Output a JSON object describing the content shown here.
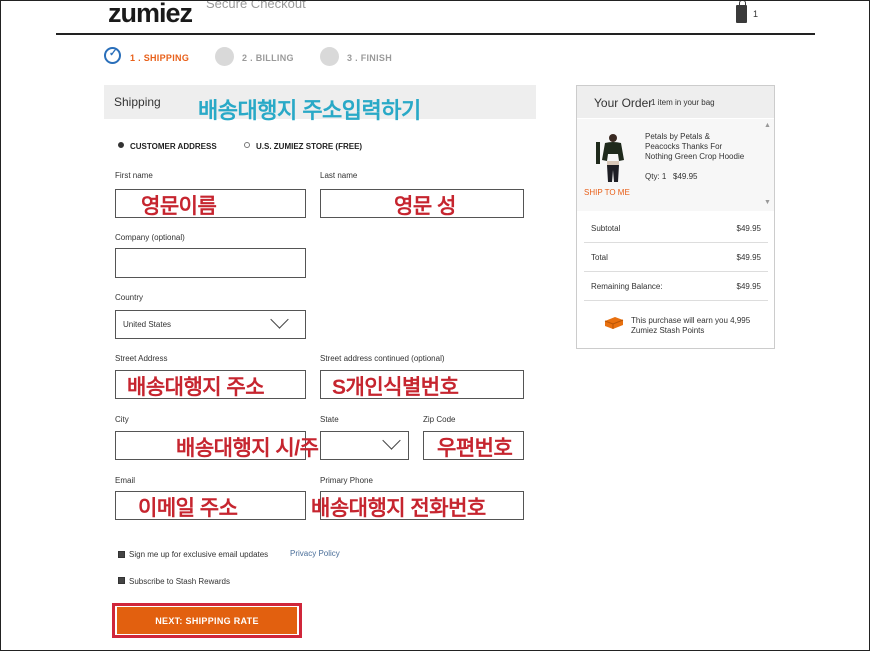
{
  "header": {
    "logo": "zumiez",
    "secure_text": "Secure Checkout",
    "bag_count": "1"
  },
  "steps": [
    {
      "label": "1 . SHIPPING",
      "state": "active"
    },
    {
      "label": "2 . BILLING",
      "state": "inactive"
    },
    {
      "label": "3 . FINISH",
      "state": "inactive"
    }
  ],
  "shipping": {
    "title": "Shipping",
    "annotation": "배송대행지 주소입력하기",
    "options": [
      {
        "label": "CUSTOMER ADDRESS",
        "selected": true
      },
      {
        "label": "U.S. ZUMIEZ STORE (FREE)",
        "selected": false
      }
    ]
  },
  "form": {
    "first_name": {
      "label": "First name",
      "annotation": "영문이름"
    },
    "last_name": {
      "label": "Last name",
      "annotation": "영문 성"
    },
    "company": {
      "label": "Company (optional)"
    },
    "country": {
      "label": "Country",
      "value": "United States"
    },
    "street": {
      "label": "Street Address",
      "annotation": "배송대행지 주소"
    },
    "street2": {
      "label": "Street address continued (optional)",
      "annotation": "S개인식별번호"
    },
    "city": {
      "label": "City",
      "annotation": "배송대행지 시/주"
    },
    "state": {
      "label": "State"
    },
    "zip": {
      "label": "Zip Code",
      "annotation": "우편번호"
    },
    "email": {
      "label": "Email",
      "annotation": "이메일 주소"
    },
    "phone": {
      "label": "Primary Phone",
      "annotation": "배송대행지 전화번호"
    },
    "email_optin": {
      "label": "Sign me up for exclusive email updates",
      "link": "Privacy Policy"
    },
    "stash_optin": {
      "label": "Subscribe to Stash Rewards"
    },
    "submit_label": "NEXT: SHIPPING RATE"
  },
  "order": {
    "title": "Your Order",
    "subtitle": "1 item in your bag",
    "item": {
      "name": "Petals by Petals & Peacocks Thanks For Nothing Green Crop Hoodie",
      "qty": "Qty: 1",
      "price": "$49.95",
      "ship_method": "SHIP TO ME"
    },
    "summary": [
      {
        "label": "Subtotal",
        "value": "$49.95"
      },
      {
        "label": "Total",
        "value": "$49.95"
      },
      {
        "label": "Remaining Balance:",
        "value": "$49.95"
      }
    ],
    "earn_text": "This purchase will earn you 4,995 Zumiez Stash Points"
  },
  "colors": {
    "accent": "#e2600f",
    "active_step": "#2a6fba",
    "annotation_red": "#c6252f",
    "annotation_blue": "#29a9c7"
  }
}
